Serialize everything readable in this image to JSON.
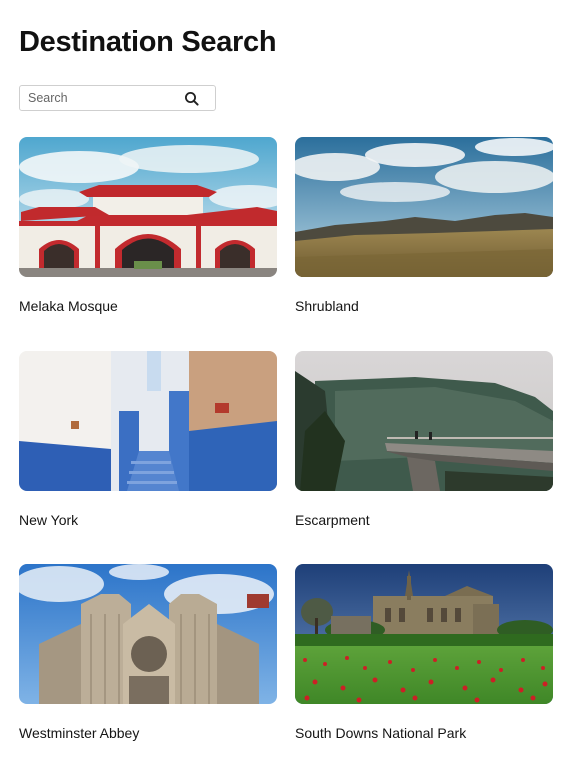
{
  "page": {
    "title": "Destination Search"
  },
  "search": {
    "placeholder": "Search",
    "value": "",
    "icon": "search-icon"
  },
  "destinations": [
    {
      "name": "Melaka Mosque"
    },
    {
      "name": "Shrubland"
    },
    {
      "name": "New York"
    },
    {
      "name": "Escarpment"
    },
    {
      "name": "Westminster Abbey"
    },
    {
      "name": "South Downs National Park"
    }
  ]
}
